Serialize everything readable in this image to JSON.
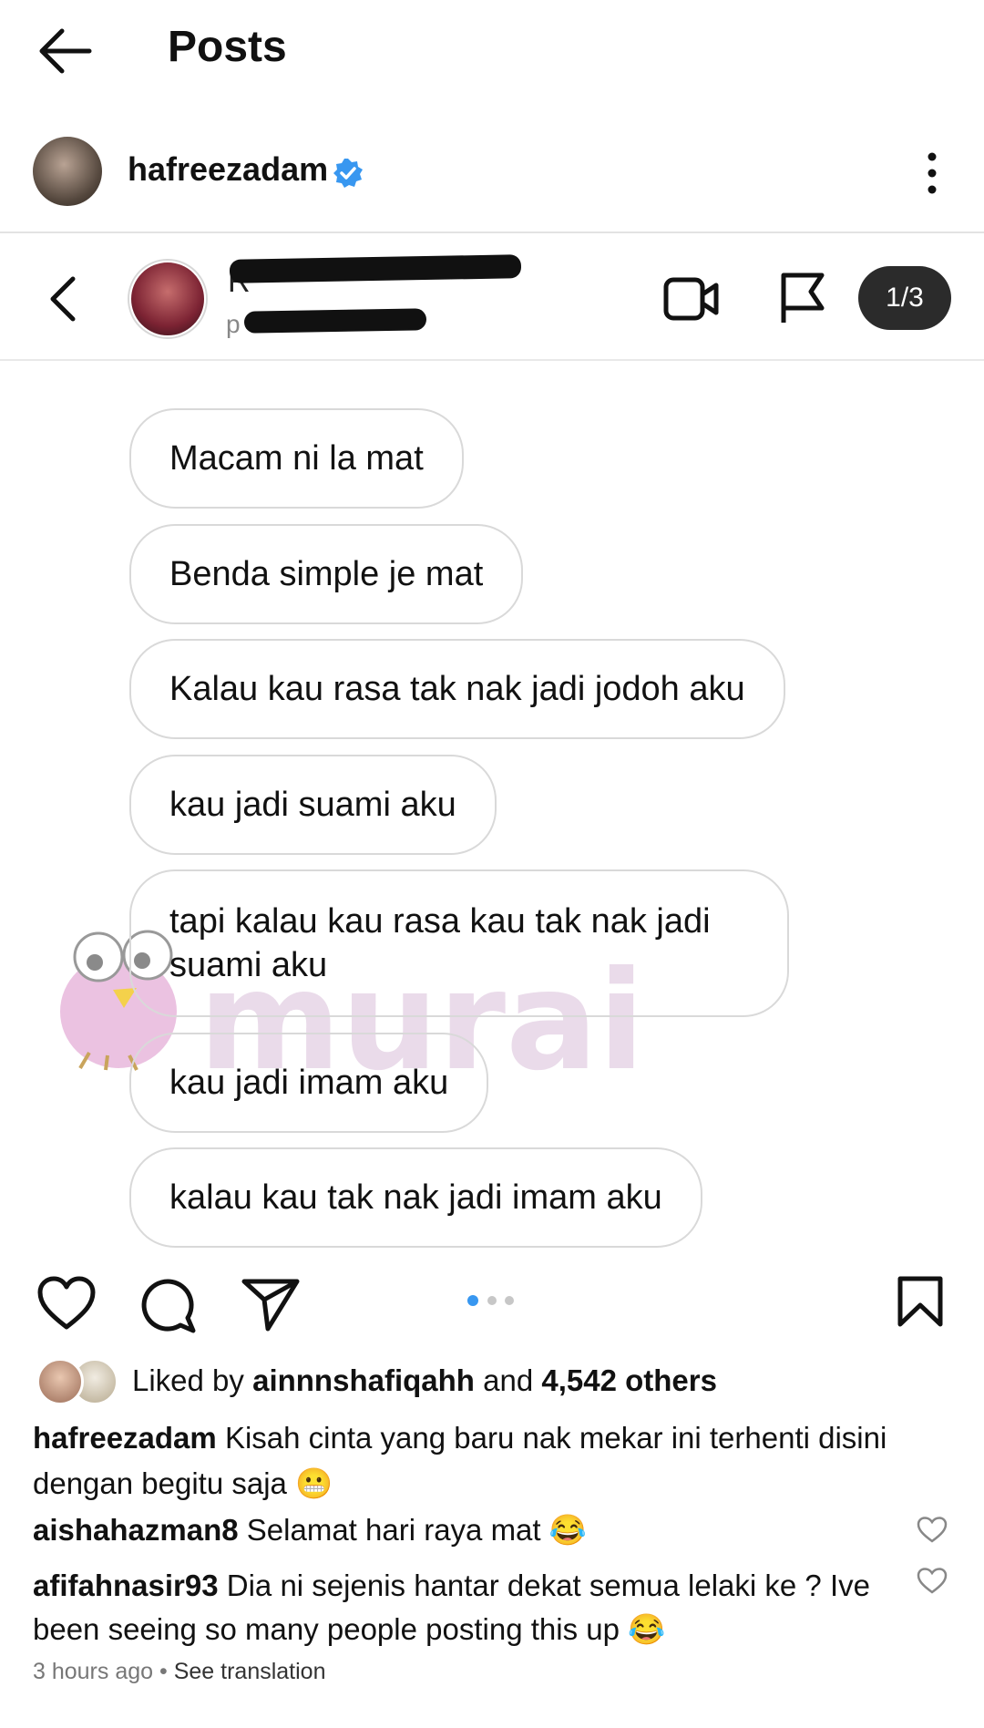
{
  "header": {
    "title": "Posts"
  },
  "post_author": {
    "username": "hafreezadam"
  },
  "screenshot": {
    "redaction_letters": [
      "R",
      "p"
    ],
    "pager": "1/3",
    "messages": [
      "Macam ni la mat",
      "Benda simple je mat",
      "Kalau kau rasa tak nak jadi jodoh aku",
      "kau jadi suami aku",
      "tapi kalau kau rasa kau tak nak jadi suami aku",
      "kau jadi imam aku",
      "kalau kau tak nak jadi imam aku"
    ],
    "watermark": "murai"
  },
  "likes": {
    "prefix": "Liked by",
    "user": "ainnnshafiqahh",
    "middle": "and",
    "count": "4,542 others"
  },
  "caption": {
    "username": "hafreezadam",
    "text": "Kisah cinta yang baru nak mekar ini terhenti disini dengan begitu saja 😬"
  },
  "comments": [
    {
      "username": "aishahazman8",
      "text": "Selamat hari raya mat 😂"
    },
    {
      "username": "afifahnasir93",
      "text": "Dia ni sejenis hantar dekat semua lelaki ke ? Ive been seeing so many people posting this up 😂"
    }
  ],
  "meta": {
    "time": "3 hours ago",
    "separator": "•",
    "translate": "See translation"
  },
  "colors": {
    "verified": "#3897f0",
    "active_dot": "#3897f0",
    "inactive_dot": "#c7c7c7"
  }
}
